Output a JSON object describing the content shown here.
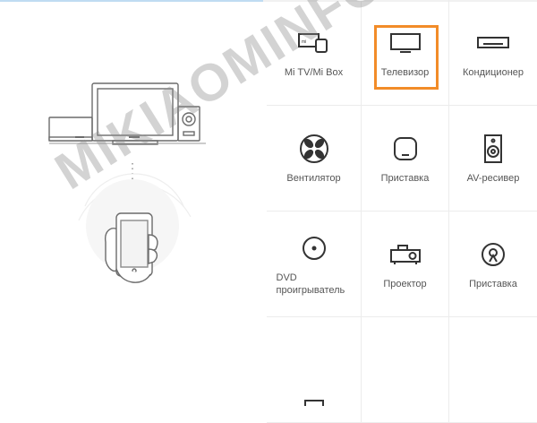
{
  "progress": {
    "fraction": 0.49,
    "color": "#bfdcf2"
  },
  "illustration": {
    "icons": [
      "tv-monitor",
      "set-top-box",
      "speaker",
      "phone-in-hand",
      "signal-waves"
    ]
  },
  "devices": [
    {
      "label": "Mi TV/Mi Box",
      "icon": "mi-tv-box-icon",
      "selected": false
    },
    {
      "label": "Телевизор",
      "icon": "tv-icon",
      "selected": true
    },
    {
      "label": "Кондиционер",
      "icon": "air-conditioner-icon",
      "selected": false
    },
    {
      "label": "Вентилятор",
      "icon": "fan-icon",
      "selected": false
    },
    {
      "label": "Приставка",
      "icon": "set-top-box-icon",
      "selected": false
    },
    {
      "label": "AV-ресивер",
      "icon": "av-receiver-icon",
      "selected": false
    },
    {
      "label": "DVD проигрыватель",
      "icon": "dvd-player-icon",
      "selected": false
    },
    {
      "label": "Проектор",
      "icon": "projector-icon",
      "selected": false
    },
    {
      "label": "Приставка",
      "icon": "satellite-box-icon",
      "selected": false
    },
    {
      "label": "",
      "icon": "partial-icon",
      "selected": false
    },
    {
      "label": "",
      "icon": "",
      "selected": false
    },
    {
      "label": "",
      "icon": "",
      "selected": false
    }
  ],
  "selection_color": "#f28c28",
  "watermark": {
    "text": "MIKIAOMINFO.RU"
  }
}
